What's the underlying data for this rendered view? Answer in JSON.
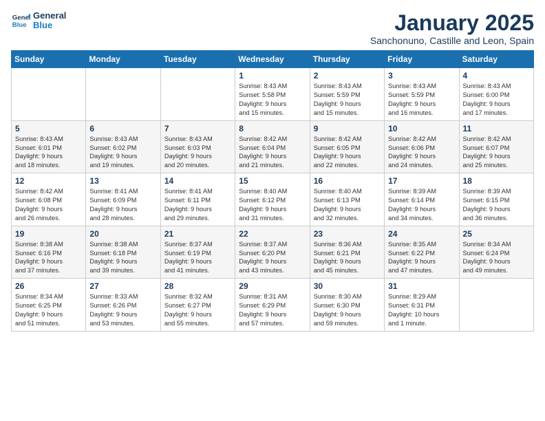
{
  "logo": {
    "line1": "General",
    "line2": "Blue"
  },
  "header": {
    "title": "January 2025",
    "subtitle": "Sanchonuno, Castille and Leon, Spain"
  },
  "weekdays": [
    "Sunday",
    "Monday",
    "Tuesday",
    "Wednesday",
    "Thursday",
    "Friday",
    "Saturday"
  ],
  "weeks": [
    [
      {
        "day": "",
        "info": ""
      },
      {
        "day": "",
        "info": ""
      },
      {
        "day": "",
        "info": ""
      },
      {
        "day": "1",
        "info": "Sunrise: 8:43 AM\nSunset: 5:58 PM\nDaylight: 9 hours\nand 15 minutes."
      },
      {
        "day": "2",
        "info": "Sunrise: 8:43 AM\nSunset: 5:59 PM\nDaylight: 9 hours\nand 15 minutes."
      },
      {
        "day": "3",
        "info": "Sunrise: 8:43 AM\nSunset: 5:59 PM\nDaylight: 9 hours\nand 16 minutes."
      },
      {
        "day": "4",
        "info": "Sunrise: 8:43 AM\nSunset: 6:00 PM\nDaylight: 9 hours\nand 17 minutes."
      }
    ],
    [
      {
        "day": "5",
        "info": "Sunrise: 8:43 AM\nSunset: 6:01 PM\nDaylight: 9 hours\nand 18 minutes."
      },
      {
        "day": "6",
        "info": "Sunrise: 8:43 AM\nSunset: 6:02 PM\nDaylight: 9 hours\nand 19 minutes."
      },
      {
        "day": "7",
        "info": "Sunrise: 8:43 AM\nSunset: 6:03 PM\nDaylight: 9 hours\nand 20 minutes."
      },
      {
        "day": "8",
        "info": "Sunrise: 8:42 AM\nSunset: 6:04 PM\nDaylight: 9 hours\nand 21 minutes."
      },
      {
        "day": "9",
        "info": "Sunrise: 8:42 AM\nSunset: 6:05 PM\nDaylight: 9 hours\nand 22 minutes."
      },
      {
        "day": "10",
        "info": "Sunrise: 8:42 AM\nSunset: 6:06 PM\nDaylight: 9 hours\nand 24 minutes."
      },
      {
        "day": "11",
        "info": "Sunrise: 8:42 AM\nSunset: 6:07 PM\nDaylight: 9 hours\nand 25 minutes."
      }
    ],
    [
      {
        "day": "12",
        "info": "Sunrise: 8:42 AM\nSunset: 6:08 PM\nDaylight: 9 hours\nand 26 minutes."
      },
      {
        "day": "13",
        "info": "Sunrise: 8:41 AM\nSunset: 6:09 PM\nDaylight: 9 hours\nand 28 minutes."
      },
      {
        "day": "14",
        "info": "Sunrise: 8:41 AM\nSunset: 6:11 PM\nDaylight: 9 hours\nand 29 minutes."
      },
      {
        "day": "15",
        "info": "Sunrise: 8:40 AM\nSunset: 6:12 PM\nDaylight: 9 hours\nand 31 minutes."
      },
      {
        "day": "16",
        "info": "Sunrise: 8:40 AM\nSunset: 6:13 PM\nDaylight: 9 hours\nand 32 minutes."
      },
      {
        "day": "17",
        "info": "Sunrise: 8:39 AM\nSunset: 6:14 PM\nDaylight: 9 hours\nand 34 minutes."
      },
      {
        "day": "18",
        "info": "Sunrise: 8:39 AM\nSunset: 6:15 PM\nDaylight: 9 hours\nand 36 minutes."
      }
    ],
    [
      {
        "day": "19",
        "info": "Sunrise: 8:38 AM\nSunset: 6:16 PM\nDaylight: 9 hours\nand 37 minutes."
      },
      {
        "day": "20",
        "info": "Sunrise: 8:38 AM\nSunset: 6:18 PM\nDaylight: 9 hours\nand 39 minutes."
      },
      {
        "day": "21",
        "info": "Sunrise: 8:37 AM\nSunset: 6:19 PM\nDaylight: 9 hours\nand 41 minutes."
      },
      {
        "day": "22",
        "info": "Sunrise: 8:37 AM\nSunset: 6:20 PM\nDaylight: 9 hours\nand 43 minutes."
      },
      {
        "day": "23",
        "info": "Sunrise: 8:36 AM\nSunset: 6:21 PM\nDaylight: 9 hours\nand 45 minutes."
      },
      {
        "day": "24",
        "info": "Sunrise: 8:35 AM\nSunset: 6:22 PM\nDaylight: 9 hours\nand 47 minutes."
      },
      {
        "day": "25",
        "info": "Sunrise: 8:34 AM\nSunset: 6:24 PM\nDaylight: 9 hours\nand 49 minutes."
      }
    ],
    [
      {
        "day": "26",
        "info": "Sunrise: 8:34 AM\nSunset: 6:25 PM\nDaylight: 9 hours\nand 51 minutes."
      },
      {
        "day": "27",
        "info": "Sunrise: 8:33 AM\nSunset: 6:26 PM\nDaylight: 9 hours\nand 53 minutes."
      },
      {
        "day": "28",
        "info": "Sunrise: 8:32 AM\nSunset: 6:27 PM\nDaylight: 9 hours\nand 55 minutes."
      },
      {
        "day": "29",
        "info": "Sunrise: 8:31 AM\nSunset: 6:29 PM\nDaylight: 9 hours\nand 57 minutes."
      },
      {
        "day": "30",
        "info": "Sunrise: 8:30 AM\nSunset: 6:30 PM\nDaylight: 9 hours\nand 59 minutes."
      },
      {
        "day": "31",
        "info": "Sunrise: 8:29 AM\nSunset: 6:31 PM\nDaylight: 10 hours\nand 1 minute."
      },
      {
        "day": "",
        "info": ""
      }
    ]
  ]
}
